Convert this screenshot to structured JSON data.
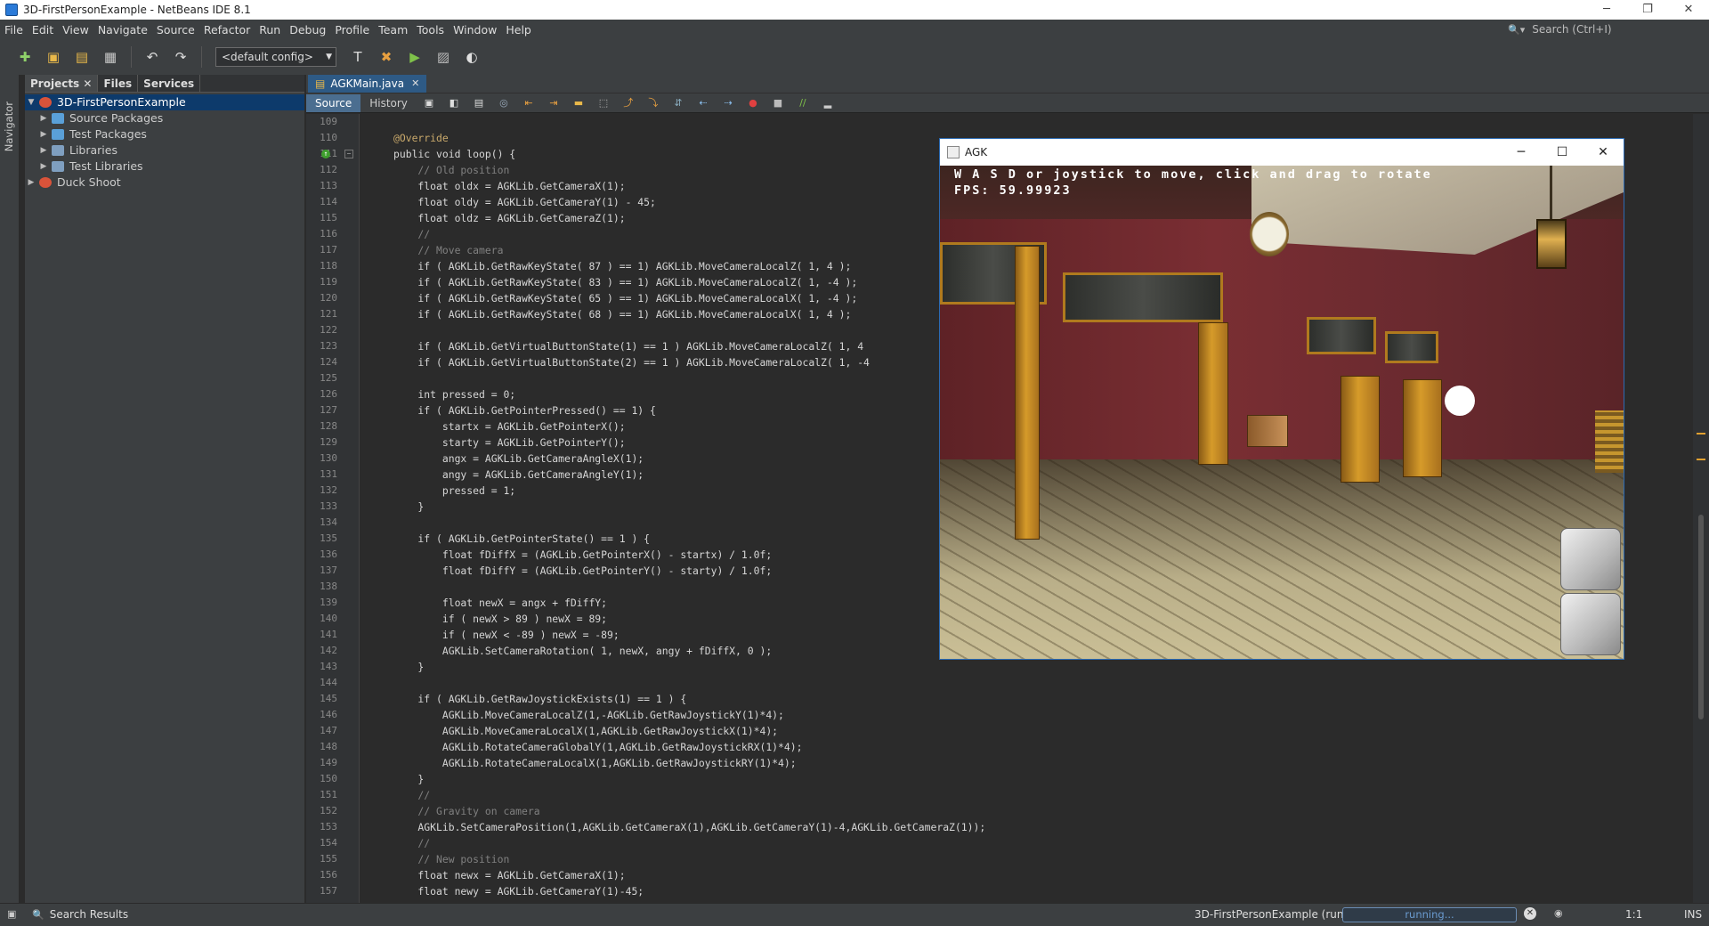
{
  "window": {
    "title": "3D-FirstPersonExample - NetBeans IDE 8.1",
    "controls": [
      "─",
      "❐",
      "✕"
    ]
  },
  "menu": {
    "items": [
      "File",
      "Edit",
      "View",
      "Navigate",
      "Source",
      "Refactor",
      "Run",
      "Debug",
      "Profile",
      "Team",
      "Tools",
      "Window",
      "Help"
    ],
    "search_placeholder": "Search (Ctrl+I)"
  },
  "toolbar": {
    "config_value": "<default config>"
  },
  "left_strip": {
    "navigator_label": "Navigator"
  },
  "projects_panel": {
    "tabs": [
      "Projects",
      "Files",
      "Services"
    ],
    "tree": [
      {
        "label": "3D-FirstPersonExample",
        "level": 0,
        "expanded": true,
        "selected": true,
        "icon": "project-icon"
      },
      {
        "label": "Source Packages",
        "level": 1,
        "icon": "source-packages-icon"
      },
      {
        "label": "Test Packages",
        "level": 1,
        "icon": "test-packages-icon"
      },
      {
        "label": "Libraries",
        "level": 1,
        "icon": "libraries-icon"
      },
      {
        "label": "Test Libraries",
        "level": 1,
        "icon": "test-libraries-icon"
      },
      {
        "label": "Duck Shoot",
        "level": 0,
        "icon": "project-icon"
      }
    ]
  },
  "editor": {
    "tab": {
      "label": "AGKMain.java"
    },
    "source_tab": "Source",
    "history_tab": "History",
    "line_start": 109,
    "lines": [
      "",
      "@Override",
      "public void loop() {",
      "    // Old position",
      "    float oldx = AGKLib.GetCameraX(1);",
      "    float oldy = AGKLib.GetCameraY(1) - 45;",
      "    float oldz = AGKLib.GetCameraZ(1);",
      "    //",
      "    // Move camera",
      "    if ( AGKLib.GetRawKeyState( 87 ) == 1) AGKLib.MoveCameraLocalZ( 1, 4 );",
      "    if ( AGKLib.GetRawKeyState( 83 ) == 1) AGKLib.MoveCameraLocalZ( 1, -4 );",
      "    if ( AGKLib.GetRawKeyState( 65 ) == 1) AGKLib.MoveCameraLocalX( 1, -4 );",
      "    if ( AGKLib.GetRawKeyState( 68 ) == 1) AGKLib.MoveCameraLocalX( 1, 4 );",
      "",
      "    if ( AGKLib.GetVirtualButtonState(1) == 1 ) AGKLib.MoveCameraLocalZ( 1, 4",
      "    if ( AGKLib.GetVirtualButtonState(2) == 1 ) AGKLib.MoveCameraLocalZ( 1, -4",
      "",
      "    int pressed = 0;",
      "    if ( AGKLib.GetPointerPressed() == 1) {",
      "        startx = AGKLib.GetPointerX();",
      "        starty = AGKLib.GetPointerY();",
      "        angx = AGKLib.GetCameraAngleX(1);",
      "        angy = AGKLib.GetCameraAngleY(1);",
      "        pressed = 1;",
      "    }",
      "",
      "    if ( AGKLib.GetPointerState() == 1 ) {",
      "        float fDiffX = (AGKLib.GetPointerX() - startx) / 1.0f;",
      "        float fDiffY = (AGKLib.GetPointerY() - starty) / 1.0f;",
      "",
      "        float newX = angx + fDiffY;",
      "        if ( newX > 89 ) newX = 89;",
      "        if ( newX < -89 ) newX = -89;",
      "        AGKLib.SetCameraRotation( 1, newX, angy + fDiffX, 0 );",
      "    }",
      "",
      "    if ( AGKLib.GetRawJoystickExists(1) == 1 ) {",
      "        AGKLib.MoveCameraLocalZ(1,-AGKLib.GetRawJoystickY(1)*4);",
      "        AGKLib.MoveCameraLocalX(1,AGKLib.GetRawJoystickX(1)*4);",
      "        AGKLib.RotateCameraGlobalY(1,AGKLib.GetRawJoystickRX(1)*4);",
      "        AGKLib.RotateCameraLocalX(1,AGKLib.GetRawJoystickRY(1)*4);",
      "    }",
      "    //",
      "    // Gravity on camera",
      "    AGKLib.SetCameraPosition(1,AGKLib.GetCameraX(1),AGKLib.GetCameraY(1)-4,AGKLib.GetCameraZ(1));",
      "    //",
      "    // New position",
      "    float newx = AGKLib.GetCameraX(1);",
      "    float newy = AGKLib.GetCameraY(1)-45;"
    ]
  },
  "agk_window": {
    "title": "AGK",
    "controls": [
      "─",
      "☐",
      "✕"
    ],
    "hud_line1": "W A S D or joystick to move, click and drag to rotate",
    "hud_line2": "FPS: 59.99923"
  },
  "status": {
    "search_results": "Search Results",
    "run_label": "3D-FirstPersonExample (run)",
    "progress_label": "running...",
    "position": "1:1",
    "mode": "INS"
  }
}
